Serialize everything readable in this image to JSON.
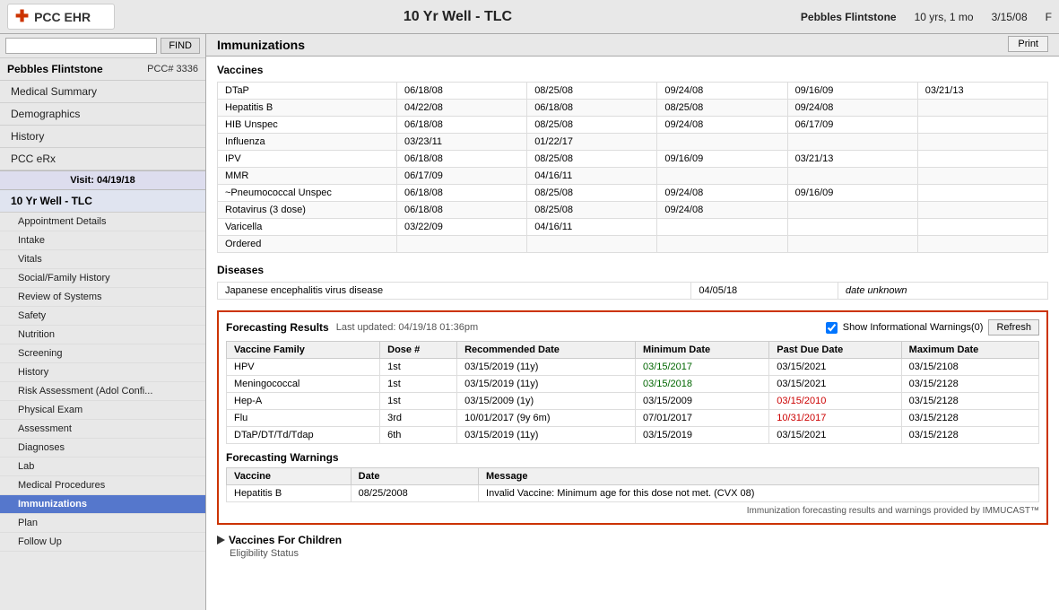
{
  "app": {
    "title": "PCC EHR",
    "logo_symbol": "✚",
    "encounter_title": "10 Yr Well - TLC"
  },
  "patient": {
    "name": "Pebbles Flintstone",
    "pcc": "PCC# 3336",
    "age": "10 yrs, 1 mo",
    "date": "3/15/08",
    "sex": "F"
  },
  "search": {
    "placeholder": "",
    "find_label": "FIND"
  },
  "sidebar": {
    "top_nav": [
      {
        "label": "Medical Summary",
        "active": false
      },
      {
        "label": "Demographics",
        "active": false
      },
      {
        "label": "History",
        "active": false
      },
      {
        "label": "PCC eRx",
        "active": false
      }
    ],
    "visit_label": "Visit: 04/19/18",
    "visit_name": "10 Yr Well - TLC",
    "visit_nav": [
      {
        "label": "Appointment Details",
        "active": false
      },
      {
        "label": "Intake",
        "active": false
      },
      {
        "label": "Vitals",
        "active": false
      },
      {
        "label": "Social/Family History",
        "active": false
      },
      {
        "label": "Review of Systems",
        "active": false
      },
      {
        "label": "Safety",
        "active": false
      },
      {
        "label": "Nutrition",
        "active": false
      },
      {
        "label": "Screening",
        "active": false
      },
      {
        "label": "History",
        "active": false
      },
      {
        "label": "Risk Assessment (Adol Confi...",
        "active": false
      },
      {
        "label": "Physical Exam",
        "active": false
      },
      {
        "label": "Assessment",
        "active": false
      },
      {
        "label": "Diagnoses",
        "active": false
      },
      {
        "label": "Lab",
        "active": false
      },
      {
        "label": "Medical Procedures",
        "active": false
      },
      {
        "label": "Immunizations",
        "active": true
      },
      {
        "label": "Plan",
        "active": false
      },
      {
        "label": "Follow Up",
        "active": false
      }
    ]
  },
  "content": {
    "header": "Immunizations",
    "print_label": "Print",
    "vaccines_title": "Vaccines",
    "vaccines": [
      {
        "name": "DTaP",
        "dates": [
          "06/18/08",
          "08/25/08",
          "09/24/08",
          "09/16/09",
          "03/21/13"
        ]
      },
      {
        "name": "Hepatitis B",
        "dates": [
          "04/22/08",
          "06/18/08",
          "08/25/08",
          "09/24/08",
          ""
        ]
      },
      {
        "name": "HIB Unspec",
        "dates": [
          "06/18/08",
          "08/25/08",
          "09/24/08",
          "06/17/09",
          ""
        ]
      },
      {
        "name": "Influenza",
        "dates": [
          "03/23/11",
          "01/22/17",
          "",
          "",
          ""
        ]
      },
      {
        "name": "IPV",
        "dates": [
          "06/18/08",
          "08/25/08",
          "09/16/09",
          "03/21/13",
          ""
        ]
      },
      {
        "name": "MMR",
        "dates": [
          "06/17/09",
          "04/16/11",
          "",
          "",
          ""
        ]
      },
      {
        "name": "~Pneumococcal Unspec",
        "dates": [
          "06/18/08",
          "08/25/08",
          "09/24/08",
          "09/16/09",
          ""
        ]
      },
      {
        "name": "Rotavirus (3 dose)",
        "dates": [
          "06/18/08",
          "08/25/08",
          "09/24/08",
          "",
          ""
        ]
      },
      {
        "name": "Varicella",
        "dates": [
          "03/22/09",
          "04/16/11",
          "",
          "",
          ""
        ]
      },
      {
        "name": "Ordered",
        "dates": [
          "",
          "",
          "",
          "",
          ""
        ]
      }
    ],
    "diseases_title": "Diseases",
    "diseases": [
      {
        "name": "Japanese encephalitis virus disease",
        "date": "04/05/18",
        "note": "date unknown"
      }
    ],
    "forecasting": {
      "title": "Forecasting Results",
      "updated": "Last updated: 04/19/18 01:36pm",
      "show_warnings_label": "Show Informational Warnings(0)",
      "refresh_label": "Refresh",
      "columns": [
        "Vaccine Family",
        "Dose #",
        "Recommended Date",
        "Minimum Date",
        "Past Due Date",
        "Maximum Date"
      ],
      "rows": [
        {
          "family": "HPV",
          "dose": "1st",
          "recommended": "03/15/2019 (11y)",
          "minimum": "03/15/2017",
          "past_due": "03/15/2021",
          "maximum": "03/15/2108",
          "min_color": "green",
          "past_color": ""
        },
        {
          "family": "Meningococcal",
          "dose": "1st",
          "recommended": "03/15/2019 (11y)",
          "minimum": "03/15/2018",
          "past_due": "03/15/2021",
          "maximum": "03/15/2128",
          "min_color": "green",
          "past_color": ""
        },
        {
          "family": "Hep-A",
          "dose": "1st",
          "recommended": "03/15/2009 (1y)",
          "minimum": "03/15/2009",
          "past_due": "03/15/2010",
          "maximum": "03/15/2128",
          "min_color": "",
          "past_color": "red"
        },
        {
          "family": "Flu",
          "dose": "3rd",
          "recommended": "10/01/2017 (9y 6m)",
          "minimum": "07/01/2017",
          "past_due": "10/31/2017",
          "maximum": "03/15/2128",
          "min_color": "",
          "past_color": "red"
        },
        {
          "family": "DTaP/DT/Td/Tdap",
          "dose": "6th",
          "recommended": "03/15/2019 (11y)",
          "minimum": "03/15/2019",
          "past_due": "03/15/2021",
          "maximum": "03/15/2128",
          "min_color": "",
          "past_color": ""
        }
      ],
      "warnings_title": "Forecasting Warnings",
      "warnings_columns": [
        "Vaccine",
        "Date",
        "Message"
      ],
      "warnings": [
        {
          "vaccine": "Hepatitis B",
          "date": "08/25/2008",
          "message": "Invalid Vaccine: Minimum age for this dose not met. (CVX 08)"
        }
      ],
      "immucast_note": "Immunization forecasting results and warnings provided by IMMUCAST™"
    },
    "vfc_title": "Vaccines For Children",
    "vfc_subtitle": "Eligibility Status"
  }
}
